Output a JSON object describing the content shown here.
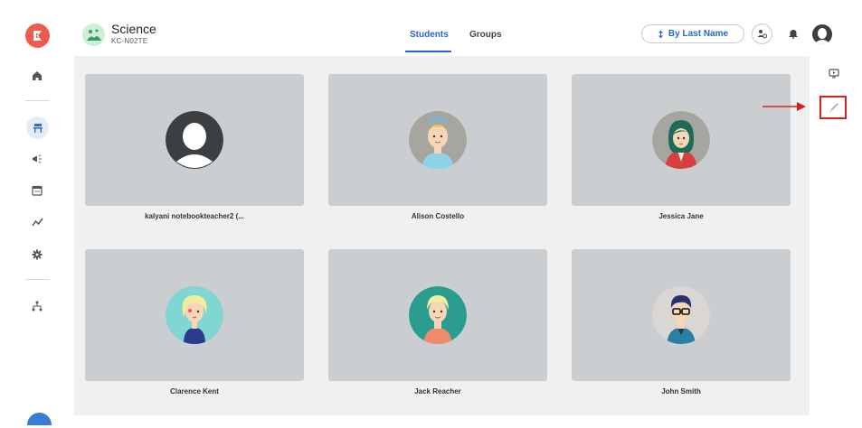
{
  "header": {
    "class_name": "Science",
    "class_code": "KC-N02TE",
    "tabs": [
      {
        "label": "Students",
        "active": true
      },
      {
        "label": "Groups",
        "active": false
      }
    ],
    "sort_label": "By Last Name"
  },
  "sidebar": {
    "items": [
      {
        "icon": "home-icon"
      },
      {
        "icon": "classroom-icon",
        "active": true
      },
      {
        "icon": "megaphone-icon"
      },
      {
        "icon": "calendar-icon"
      },
      {
        "icon": "trend-icon"
      },
      {
        "icon": "gear-icon"
      },
      {
        "icon": "hierarchy-icon"
      }
    ]
  },
  "students": [
    {
      "name": "kalyani notebookteacher2 (...",
      "avatar": "default"
    },
    {
      "name": "Alison Costello",
      "avatar": "alison"
    },
    {
      "name": "Jessica Jane",
      "avatar": "jessica"
    },
    {
      "name": "Clarence Kent",
      "avatar": "clarence"
    },
    {
      "name": "Jack Reacher",
      "avatar": "jack"
    },
    {
      "name": "John Smith",
      "avatar": "john"
    }
  ],
  "right_rail": {
    "items": [
      {
        "icon": "present-screen-icon"
      },
      {
        "icon": "pen-icon",
        "highlighted": true
      }
    ]
  },
  "colors": {
    "accent": "#2a66c8",
    "brand_logo": "#ee5a4f",
    "highlight": "#d62020",
    "card_bg": "#cbced0",
    "main_bg": "#f0f0f0"
  }
}
